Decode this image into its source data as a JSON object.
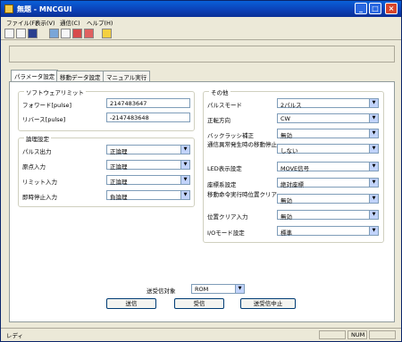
{
  "window": {
    "title": "無題 - MNCGUI"
  },
  "menu": [
    "ファイル(F)",
    "表示(V)",
    "通信(C)",
    "ヘルプ(H)"
  ],
  "tabs": [
    "パラメータ設定",
    "移動データ設定",
    "マニュアル実行"
  ],
  "software_limit": {
    "title": "ソフトウェアリミット",
    "forward_label": "フォワード[pulse]",
    "forward_value": "2147483647",
    "reverse_label": "リバース[pulse]",
    "reverse_value": "-2147483648"
  },
  "logic": {
    "title": "論理設定",
    "rows": [
      {
        "label": "パルス出力",
        "value": "正論理"
      },
      {
        "label": "原点入力",
        "value": "正論理"
      },
      {
        "label": "リミット入力",
        "value": "正論理"
      },
      {
        "label": "即時停止入力",
        "value": "負論理"
      }
    ]
  },
  "other": {
    "title": "その他",
    "rows": [
      {
        "label": "パルスモード",
        "value": "2パルス"
      },
      {
        "label": "正転方向",
        "value": "CW"
      },
      {
        "label": "バックラッシ補正",
        "value": "無効"
      },
      {
        "label": "通信異常発生時の移動停止",
        "value": "しない"
      },
      {
        "label": "LED表示設定",
        "value": "MOVE信号"
      },
      {
        "label": "座標系設定",
        "value": "絶対座標"
      },
      {
        "label": "移動命令実行時位置クリア",
        "value": "無効"
      },
      {
        "label": "位置クリア入力",
        "value": "無効"
      },
      {
        "label": "I/Oモード設定",
        "value": "標準"
      }
    ]
  },
  "transfer": {
    "label": "送受信対象",
    "value": "ROM",
    "send": "送信",
    "receive": "受信",
    "abort": "送受信中止"
  },
  "status": {
    "ready": "レディ",
    "num": "NUM"
  }
}
